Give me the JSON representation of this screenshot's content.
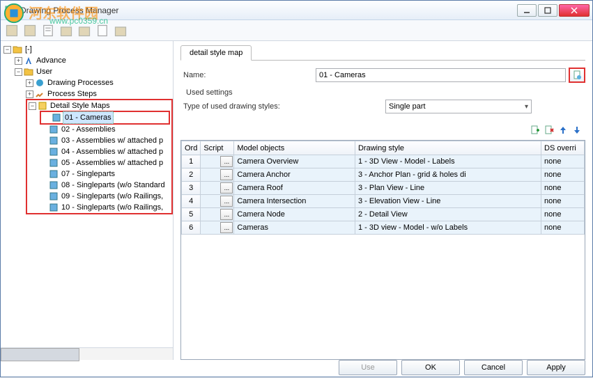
{
  "title": "Drawing Process Manager",
  "watermark_text": "河东软件园",
  "watermark_url": "www.pc0359.cn",
  "tree": {
    "root": "[-]",
    "advance": "Advance",
    "user": "User",
    "drawing_processes": "Drawing Processes",
    "process_steps": "Process Steps",
    "detail_style_maps": "Detail Style Maps",
    "items": [
      "01 - Cameras",
      "02 - Assemblies",
      "03 - Assemblies w/ attached p",
      "04 - Assemblies w/ attached p",
      "05 - Assemblies w/ attached p",
      "07 - Singleparts",
      "08 - Singleparts (w/o Standard",
      "09 - Singleparts (w/o Railings,",
      "10 - Singleparts (w/o Railings,"
    ]
  },
  "tab": {
    "label": "detail style map"
  },
  "form": {
    "name_label": "Name:",
    "name_value": "01 - Cameras",
    "used_settings": "Used settings",
    "type_label": "Type of used drawing styles:",
    "type_value": "Single part"
  },
  "grid": {
    "headers": {
      "ord": "Ord",
      "script": "Script",
      "model": "Model objects",
      "style": "Drawing style",
      "override": "DS overri"
    },
    "rows": [
      {
        "ord": "1",
        "model": "Camera Overview",
        "style": "1 - 3D View - Model - Labels",
        "override": "none"
      },
      {
        "ord": "2",
        "model": "Camera Anchor",
        "style": "3 - Anchor Plan - grid & holes di",
        "override": "none"
      },
      {
        "ord": "3",
        "model": "Camera Roof",
        "style": "3 - Plan View - Line",
        "override": "none"
      },
      {
        "ord": "4",
        "model": "Camera Intersection",
        "style": "3 - Elevation View - Line",
        "override": "none"
      },
      {
        "ord": "5",
        "model": "Camera Node",
        "style": "2 - Detail View",
        "override": "none"
      },
      {
        "ord": "6",
        "model": "Cameras",
        "style": "1 - 3D view - Model - w/o Labels",
        "override": "none"
      }
    ]
  },
  "buttons": {
    "use": "Use",
    "ok": "OK",
    "cancel": "Cancel",
    "apply": "Apply"
  }
}
